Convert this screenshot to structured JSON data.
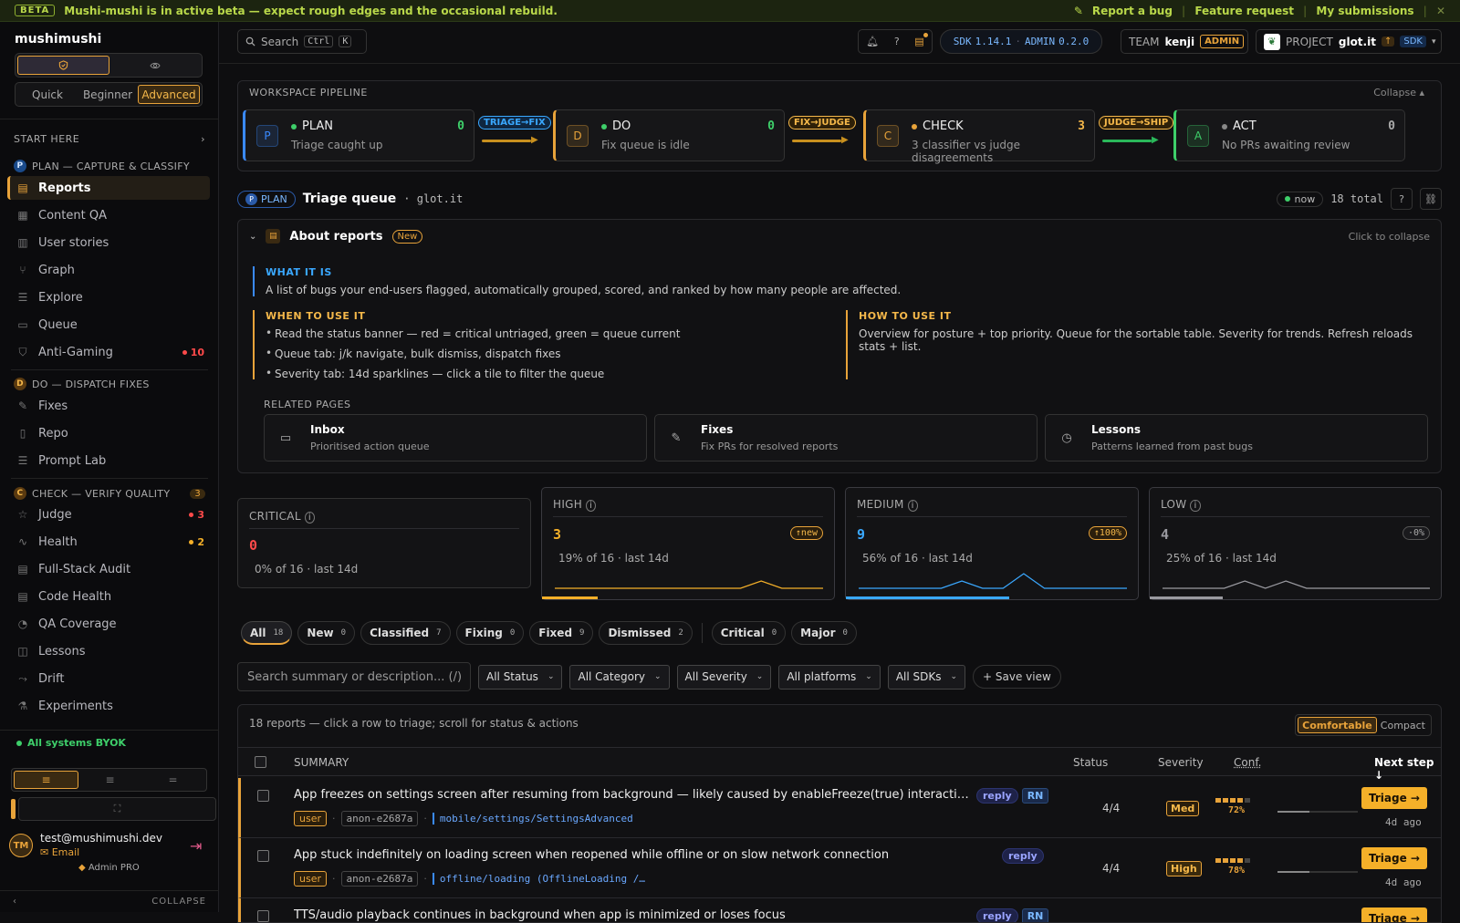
{
  "banner": {
    "badge": "BETA",
    "message": "Mushi-mushi is in active beta — expect rough edges and the occasional rebuild.",
    "report_bug": "Report a bug",
    "feature_request": "Feature request",
    "my_submissions": "My submissions"
  },
  "sidebar": {
    "brand": "mushimushi",
    "levels": [
      "Quick",
      "Beginner",
      "Advanced"
    ],
    "active_level": "Advanced",
    "start_here": "START HERE",
    "groups": [
      {
        "badge": "P",
        "label": "PLAN — CAPTURE & CLASSIFY"
      },
      {
        "badge": "D",
        "label": "DO — DISPATCH FIXES"
      },
      {
        "badge": "C",
        "label": "CHECK — VERIFY QUALITY",
        "count": "3"
      }
    ],
    "plan_items": [
      {
        "label": "Reports",
        "icon": "reports-icon"
      },
      {
        "label": "Content QA",
        "icon": "content-qa-icon"
      },
      {
        "label": "User stories",
        "icon": "user-stories-icon"
      },
      {
        "label": "Graph",
        "icon": "graph-icon"
      },
      {
        "label": "Explore",
        "icon": "explore-icon"
      },
      {
        "label": "Queue",
        "icon": "queue-icon"
      },
      {
        "label": "Anti-Gaming",
        "icon": "shield-icon",
        "badge": "10"
      }
    ],
    "do_items": [
      {
        "label": "Fixes",
        "icon": "wrench-icon"
      },
      {
        "label": "Repo",
        "icon": "repo-icon"
      },
      {
        "label": "Prompt Lab",
        "icon": "prompt-lab-icon"
      }
    ],
    "check_items": [
      {
        "label": "Judge",
        "icon": "star-icon",
        "badge": "3"
      },
      {
        "label": "Health",
        "icon": "pulse-icon",
        "badge": "2"
      },
      {
        "label": "Full-Stack Audit",
        "icon": "audit-icon"
      },
      {
        "label": "Code Health",
        "icon": "code-health-icon"
      },
      {
        "label": "QA Coverage",
        "icon": "coverage-icon"
      },
      {
        "label": "Lessons",
        "icon": "book-icon"
      },
      {
        "label": "Drift",
        "icon": "drift-icon"
      },
      {
        "label": "Experiments",
        "icon": "flask-icon"
      }
    ],
    "systems": "All systems BYOK",
    "user": {
      "initials": "TM",
      "email": "test@mushimushi.dev",
      "provider": "Email",
      "role": "Admin PRO"
    },
    "collapse": "COLLAPSE"
  },
  "topbar": {
    "search_label": "Search",
    "kbd_ctrl": "Ctrl",
    "kbd_k": "K",
    "sdk_label": "SDK",
    "sdk_version": "1.14.1",
    "admin_label": "ADMIN",
    "admin_version": "0.2.0",
    "team_label": "TEAM",
    "team_name": "kenji",
    "team_role": "ADMIN",
    "project_label": "PROJECT",
    "project_name": "glot.it",
    "project_sdk": "SDK"
  },
  "pipeline": {
    "title": "WORKSPACE PIPELINE",
    "collapse": "Collapse ▴",
    "stages": [
      {
        "letter": "P",
        "name": "PLAN",
        "sub": "Triage caught up",
        "count": "0",
        "color": "#3a8aff",
        "dot": "#3ecf6a",
        "count_color": "#3ecf6a"
      },
      {
        "letter": "D",
        "name": "DO",
        "sub": "Fix queue is idle",
        "count": "0",
        "color": "#e8a33a",
        "dot": "#3ecf6a",
        "count_color": "#3ecf6a"
      },
      {
        "letter": "C",
        "name": "CHECK",
        "sub": "3 classifier vs judge disagreements",
        "count": "3",
        "color": "#e8a33a",
        "dot": "#e8a33a",
        "count_color": "#f5b84a"
      },
      {
        "letter": "A",
        "name": "ACT",
        "sub": "No PRs awaiting review",
        "count": "0",
        "color": "#3ecf6a",
        "dot": "#888",
        "count_color": "#aaa"
      }
    ],
    "connectors": [
      "TRIAGE→FIX",
      "FIX→JUDGE",
      "JUDGE→SHIP"
    ]
  },
  "triage": {
    "stage_pill": "PLAN",
    "title": "Triage queue",
    "project": "· glot.it",
    "updated": "now",
    "total": "18 total",
    "help": "?"
  },
  "about": {
    "title": "About reports",
    "new_badge": "New",
    "collapse_hint": "Click to collapse",
    "what_h": "WHAT IT IS",
    "what_p": "A list of bugs your end-users flagged, automatically grouped, scored, and ranked by how many people are affected.",
    "when_h": "WHEN TO USE IT",
    "when_items": [
      "Read the status banner — red = critical untriaged, green = queue current",
      "Queue tab: j/k navigate, bulk dismiss, dispatch fixes",
      "Severity tab: 14d sparklines — click a tile to filter the queue"
    ],
    "how_h": "HOW TO USE IT",
    "how_p": "Overview for posture + top priority. Queue for the sortable table. Severity for trends. Refresh reloads stats + list.",
    "related_h": "RELATED PAGES",
    "related": [
      {
        "title": "Inbox",
        "sub": "Prioritised action queue",
        "icon": "inbox-icon"
      },
      {
        "title": "Fixes",
        "sub": "Fix PRs for resolved reports",
        "icon": "pencil-icon"
      },
      {
        "title": "Lessons",
        "sub": "Patterns learned from past bugs",
        "icon": "clock-icon"
      }
    ]
  },
  "severity": [
    {
      "label": "CRITICAL",
      "value": "0",
      "pct": "0% of 16 · last 14d",
      "delta": "",
      "color": "#ff4a4a",
      "share": 0
    },
    {
      "label": "HIGH",
      "value": "3",
      "pct": "19% of 16 · last 14d",
      "delta": "↑new",
      "color": "#f5b029",
      "share": 0.19,
      "spark": [
        0,
        0,
        0,
        0,
        0,
        0,
        0,
        0,
        0,
        0,
        1,
        0,
        0,
        0
      ]
    },
    {
      "label": "MEDIUM",
      "value": "9",
      "pct": "56% of 16 · last 14d",
      "delta": "↑100%",
      "color": "#3aa8ff",
      "share": 0.56,
      "spark": [
        0,
        0,
        0,
        0,
        0,
        1,
        0,
        0,
        2,
        0,
        0,
        0,
        0,
        0
      ]
    },
    {
      "label": "LOW",
      "value": "4",
      "pct": "25% of 16 · last 14d",
      "delta": "·0%",
      "color": "#9a9aa0",
      "share": 0.25,
      "spark": [
        0,
        0,
        0,
        0,
        1,
        0,
        1,
        0,
        0,
        0,
        0,
        0,
        0,
        0
      ]
    }
  ],
  "tabs": [
    {
      "label": "All",
      "count": "18",
      "active": true
    },
    {
      "label": "New",
      "count": "0"
    },
    {
      "label": "Classified",
      "count": "7"
    },
    {
      "label": "Fixing",
      "count": "0"
    },
    {
      "label": "Fixed",
      "count": "9"
    },
    {
      "label": "Dismissed",
      "count": "2"
    }
  ],
  "severity_tabs": [
    {
      "label": "Critical",
      "count": "0"
    },
    {
      "label": "Major",
      "count": "0"
    }
  ],
  "filters": {
    "search_placeholder": "Search summary or description... (/)",
    "selects": [
      "All Status",
      "All Category",
      "All Severity",
      "All platforms",
      "All SDKs"
    ],
    "save_view": "+ Save view"
  },
  "table": {
    "hint": "18 reports — click a row to triage; scroll for status & actions",
    "density": [
      "Comfortable",
      "Compact"
    ],
    "headers": {
      "summary": "SUMMARY",
      "status": "Status",
      "severity": "Severity",
      "conf": "Conf.",
      "next": "Next step ↓"
    },
    "rows": [
      {
        "summary": "App freezes on settings screen after resuming from background — likely caused by enableFreeze(true) interaction wi...",
        "tags": [
          "reply",
          "RN"
        ],
        "reporter": "user",
        "anon": "anon-e2687a",
        "path": "mobile/settings/SettingsAdvanced",
        "status": "4/4",
        "severity": "Med",
        "conf": "72%",
        "conf_bars": 4,
        "progress": 0.4,
        "action": "Triage →",
        "ago": "4d ago"
      },
      {
        "summary": "App stuck indefinitely on loading screen when reopened while offline or on slow network connection",
        "tags": [
          "reply"
        ],
        "reporter": "user",
        "anon": "anon-e2687a",
        "path": "offline/loading (OfflineLoading /…",
        "status": "4/4",
        "severity": "High",
        "conf": "78%",
        "conf_bars": 4,
        "progress": 0.4,
        "action": "Triage →",
        "ago": "4d ago"
      },
      {
        "summary": "TTS/audio playback continues in background when app is minimized or loses focus",
        "tags": [
          "reply",
          "RN"
        ],
        "action": "Triage →"
      }
    ]
  }
}
